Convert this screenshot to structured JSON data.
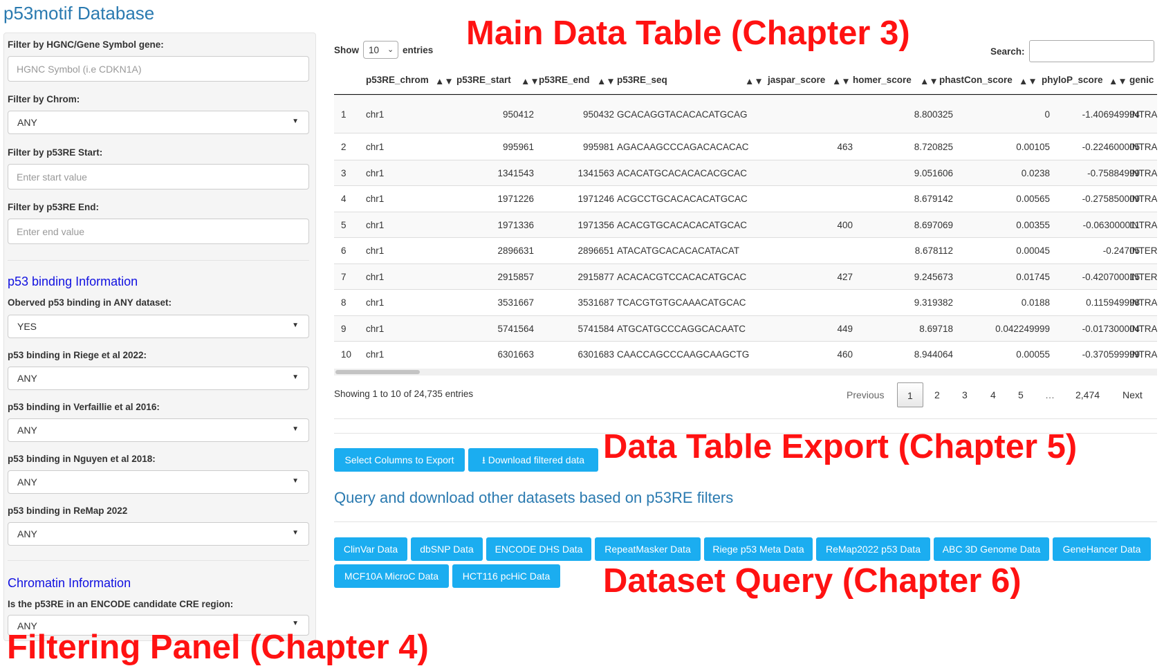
{
  "app": {
    "title": "p53motif Database"
  },
  "filters": {
    "gene_label": "Filter by HGNC/Gene Symbol gene:",
    "gene_placeholder": "HGNC Symbol (i.e CDKN1A)",
    "chrom_label": "Filter by Chrom:",
    "chrom_value": "ANY",
    "start_label": "Filter by p53RE Start:",
    "start_placeholder": "Enter start value",
    "end_label": "Filter by p53RE End:",
    "end_placeholder": "Enter end value",
    "binding_section": "p53 binding Information",
    "binding_any_label": "Oberved p53 binding in ANY dataset:",
    "binding_any_value": "YES",
    "riege_label": "p53 binding in Riege et al 2022:",
    "riege_value": "ANY",
    "verfaillie_label": "p53 binding in Verfaillie et al 2016:",
    "verfaillie_value": "ANY",
    "nguyen_label": "p53 binding in Nguyen et al 2018:",
    "nguyen_value": "ANY",
    "remap_label": "p53 binding in ReMap 2022",
    "remap_value": "ANY",
    "chromatin_section": "Chromatin Information",
    "encode_label": "Is the p53RE in an ENCODE candidate CRE region:",
    "encode_value": "ANY"
  },
  "table": {
    "show_label": "Show",
    "entries_value": "10",
    "entries_label": "entries",
    "search_label": "Search:",
    "columns": [
      "p53RE_chrom",
      "p53RE_start",
      "p53RE_end",
      "p53RE_seq",
      "jaspar_score",
      "homer_score",
      "phastCon_score",
      "phyloP_score",
      "genic"
    ],
    "rows": [
      {
        "n": "1",
        "chrom": "chr1",
        "start": "950412",
        "end": "950432",
        "seq": "GCACAGGTACACACATGCAG",
        "jaspar": "",
        "homer": "8.800325",
        "phast": "0",
        "phylo": "-1.406949994",
        "genic": "INTRA"
      },
      {
        "n": "2",
        "chrom": "chr1",
        "start": "995961",
        "end": "995981",
        "seq": "AGACAAGCCCAGACACACAC",
        "jaspar": "463",
        "homer": "8.720825",
        "phast": "0.00105",
        "phylo": "-0.224600005",
        "genic": "INTRA"
      },
      {
        "n": "3",
        "chrom": "chr1",
        "start": "1341543",
        "end": "1341563",
        "seq": "ACACATGCACACACACGCAC",
        "jaspar": "",
        "homer": "9.051606",
        "phast": "0.0238",
        "phylo": "-0.75884999",
        "genic": "INTRA"
      },
      {
        "n": "4",
        "chrom": "chr1",
        "start": "1971226",
        "end": "1971246",
        "seq": "ACGCCTGCACACACATGCAC",
        "jaspar": "",
        "homer": "8.679142",
        "phast": "0.00565",
        "phylo": "-0.275850009",
        "genic": "INTRA"
      },
      {
        "n": "5",
        "chrom": "chr1",
        "start": "1971336",
        "end": "1971356",
        "seq": "ACACGTGCACACACATGCAC",
        "jaspar": "400",
        "homer": "8.697069",
        "phast": "0.00355",
        "phylo": "-0.063000011",
        "genic": "INTRA"
      },
      {
        "n": "6",
        "chrom": "chr1",
        "start": "2896631",
        "end": "2896651",
        "seq": "ATACATGCACACACATACAT",
        "jaspar": "",
        "homer": "8.678112",
        "phast": "0.00045",
        "phylo": "-0.24705",
        "genic": "INTER"
      },
      {
        "n": "7",
        "chrom": "chr1",
        "start": "2915857",
        "end": "2915877",
        "seq": "ACACACGTCCACACATGCAC",
        "jaspar": "427",
        "homer": "9.245673",
        "phast": "0.01745",
        "phylo": "-0.420700015",
        "genic": "INTER"
      },
      {
        "n": "8",
        "chrom": "chr1",
        "start": "3531667",
        "end": "3531687",
        "seq": "TCACGTGTGCAAACATGCAC",
        "jaspar": "",
        "homer": "9.319382",
        "phast": "0.0188",
        "phylo": "0.115949998",
        "genic": "INTRA"
      },
      {
        "n": "9",
        "chrom": "chr1",
        "start": "5741564",
        "end": "5741584",
        "seq": "ATGCATGCCCAGGCACAATC",
        "jaspar": "449",
        "homer": "8.69718",
        "phast": "0.042249999",
        "phylo": "-0.017300004",
        "genic": "INTRA"
      },
      {
        "n": "10",
        "chrom": "chr1",
        "start": "6301663",
        "end": "6301683",
        "seq": "CAACCAGCCCAAGCAAGCTG",
        "jaspar": "460",
        "homer": "8.944064",
        "phast": "0.00055",
        "phylo": "-0.370599999",
        "genic": "INTRA"
      }
    ],
    "info": "Showing 1 to 10 of 24,735 entries",
    "pagination": {
      "previous": "Previous",
      "pages": [
        "1",
        "2",
        "3",
        "4",
        "5",
        "…",
        "2,474"
      ],
      "next": "Next",
      "current": "1"
    }
  },
  "export": {
    "select_columns": "Select Columns to Export",
    "download_filtered": "Download filtered data"
  },
  "query": {
    "heading": "Query and download other datasets based on p53RE filters",
    "buttons": [
      "ClinVar Data",
      "dbSNP Data",
      "ENCODE DHS Data",
      "RepeatMasker Data",
      "Riege p53 Meta Data",
      "ReMap2022 p53 Data",
      "ABC 3D Genome Data",
      "GeneHancer Data",
      "MCF10A MicroC Data",
      "HCT116 pcHiC Data"
    ]
  },
  "annotations": {
    "main_table": "Main Data Table (Chapter 3)",
    "export": "Data Table Export (Chapter 5)",
    "dataset_query": "Dataset Query (Chapter 6)",
    "filtering_panel": "Filtering Panel (Chapter 4)"
  },
  "colors": {
    "annotation": "#ff1212",
    "button": "#1badf0",
    "title": "#2a7ab0",
    "section": "#1010e0"
  }
}
